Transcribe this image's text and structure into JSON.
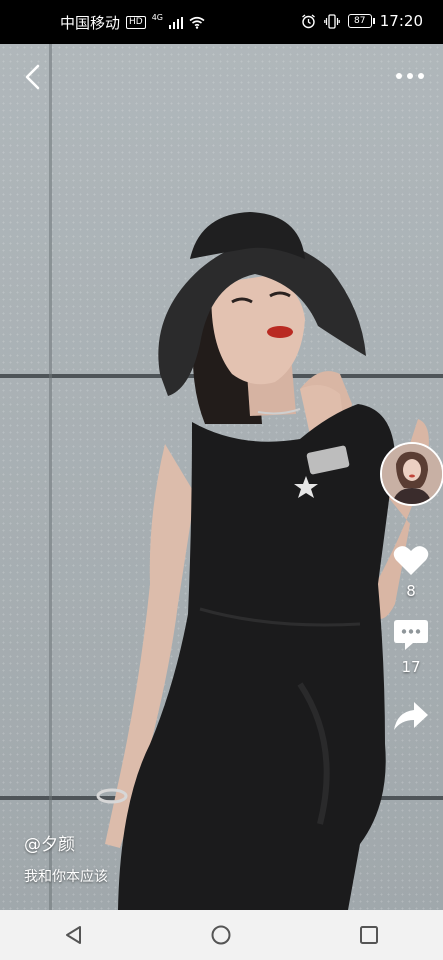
{
  "status_bar": {
    "carrier": "中国移动",
    "hd": "HD",
    "network": "4G",
    "battery": "87",
    "time": "17:20"
  },
  "video": {
    "author": "@夕颜",
    "caption": "我和你本应该"
  },
  "actions": {
    "likes": "8",
    "comments": "17"
  },
  "icons": {
    "back": "back-arrow-icon",
    "more": "more-dots-icon",
    "like": "heart-icon",
    "comment": "comment-bubble-icon",
    "share": "share-arrow-icon",
    "nav_back": "nav-back-triangle-icon",
    "nav_home": "nav-home-circle-icon",
    "nav_recent": "nav-recent-square-icon"
  }
}
